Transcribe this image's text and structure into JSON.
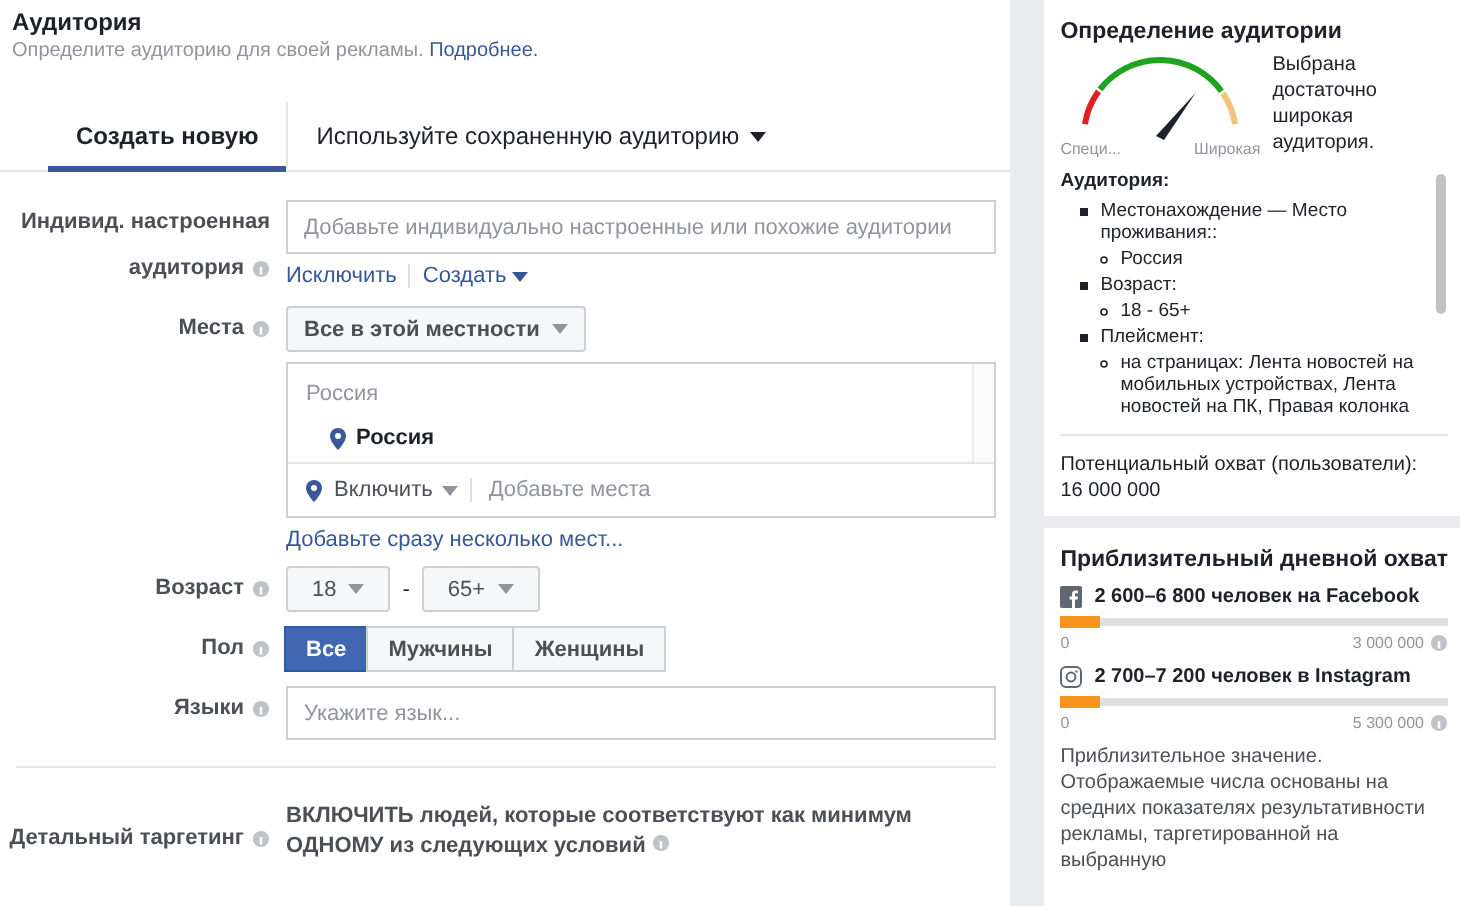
{
  "header": {
    "title": "Аудитория",
    "subtitle": "Определите аудиторию для своей рекламы.",
    "link": "Подробнее."
  },
  "tabs": [
    {
      "label": "Создать новую",
      "selected": true,
      "dropdown": false
    },
    {
      "label": "Используйте сохраненную аудиторию",
      "selected": false,
      "dropdown": true
    }
  ],
  "custom_audience": {
    "label_lines": [
      "Индивид. настроенная",
      "аудитория"
    ],
    "placeholder": "Добавьте индивидуально настроенные или похожие аудитории",
    "links": [
      {
        "label": "Исключить",
        "dropdown": false
      },
      {
        "label": "Создать",
        "dropdown": true
      }
    ]
  },
  "locations": {
    "label": "Места",
    "mode": "Все в этой местности",
    "group": "Россия",
    "items": [
      "Россия"
    ],
    "include": "Включить",
    "placeholder": "Добавьте места",
    "bulk_link": "Добавьте сразу несколько мест..."
  },
  "age": {
    "label": "Возраст",
    "from": "18",
    "separator": "-",
    "to": "65+"
  },
  "gender": {
    "label": "Пол",
    "options": [
      {
        "label": "Все",
        "selected": true
      },
      {
        "label": "Мужчины",
        "selected": false
      },
      {
        "label": "Женщины",
        "selected": false
      }
    ]
  },
  "languages": {
    "label": "Языки",
    "placeholder": "Укажите язык..."
  },
  "detailed_targeting": {
    "label": "Детальный таргетинг",
    "text": "ВКЛЮЧИТЬ людей, которые соответствуют как минимум ОДНОМУ из следующих условий"
  },
  "audience_definition": {
    "title": "Определение аудитории",
    "gauge": {
      "min_label": "Специ...",
      "max_label": "Широкая"
    },
    "verdict": "Выбрана достаточно широкая аудитория.",
    "summary_title": "Аудитория:",
    "summary": [
      {
        "text": "Местонахождение — Место проживания::",
        "children": [
          {
            "text": "Россия"
          }
        ]
      },
      {
        "text": "Возраст:",
        "children": [
          {
            "text": "18 - 65+"
          }
        ]
      },
      {
        "text": "Плейсмент:",
        "children": [
          {
            "text": "на страницах: Лента новостей на мобильных устройствах, Лента новостей на ПК, Правая колонка"
          }
        ]
      }
    ],
    "potential_reach_label": "Потенциальный охват (пользователи):",
    "potential_reach": "16 000 000"
  },
  "daily_reach": {
    "title": "Приблизительный дневной охват",
    "platforms": [
      {
        "kind": "facebook",
        "text": "2 600–6 800 человек на Facebook",
        "level": 0.1,
        "min": "0",
        "max": "3 000 000"
      },
      {
        "kind": "instagram",
        "text": "2 700–7 200 человек в Instagram",
        "level": 0.1,
        "min": "0",
        "max": "5 300 000"
      }
    ],
    "note": "Приблизительное значение. Отображаемые числа основаны на средних показателях результативности рекламы, таргетированной на выбранную"
  }
}
